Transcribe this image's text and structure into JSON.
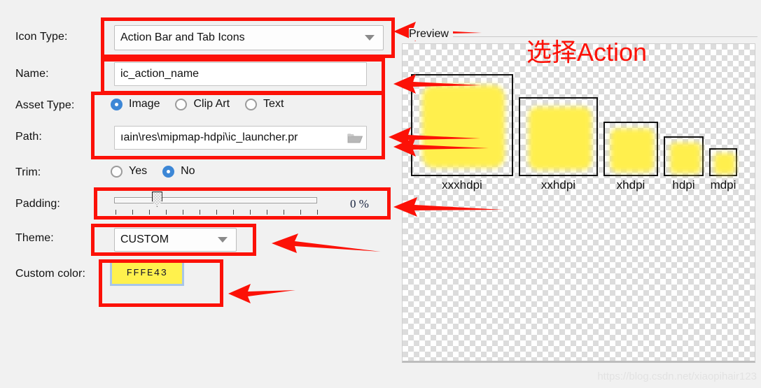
{
  "form": {
    "fields": [
      {
        "label": "Icon Type:",
        "value": "Action Bar and Tab Icons",
        "control": "combo"
      },
      {
        "label": "Name:",
        "value": "ic_action_name",
        "control": "textbox"
      },
      {
        "label": "Asset Type:",
        "control": "radio-group"
      },
      {
        "label": "Path:",
        "value": "ıain\\res\\mipmap-hdpi\\ic_launcher.pr",
        "control": "textbox"
      },
      {
        "label": "Trim:",
        "control": "radio-group"
      },
      {
        "label": "Padding:",
        "control": "slider"
      },
      {
        "label": "Theme:",
        "value": "CUSTOM",
        "control": "combo"
      },
      {
        "label": "Custom color:",
        "control": "color"
      }
    ],
    "asset_type": {
      "options": [
        "Image",
        "Clip Art",
        "Text"
      ],
      "selected": "Image"
    },
    "trim": {
      "options": [
        "Yes",
        "No"
      ],
      "selected": "No"
    },
    "padding": {
      "value": "0 %",
      "percent": 0,
      "thumb_position_percent": 21,
      "tick_count": 13
    },
    "custom_color": {
      "hex_label": "FFFE43",
      "swatch_color": "#fff14d",
      "border_color": "#a8c6e8"
    }
  },
  "preview": {
    "title": "Preview",
    "densities": [
      {
        "label": "xxxhdpi",
        "frame": 146,
        "icon": 118
      },
      {
        "label": "xxhdpi",
        "frame": 113,
        "icon": 90
      },
      {
        "label": "xhdpi",
        "frame": 78,
        "icon": 62
      },
      {
        "label": "hdpi",
        "frame": 57,
        "icon": 44
      },
      {
        "label": "mdpi",
        "frame": 40,
        "icon": 30
      }
    ]
  },
  "annotations": {
    "chinese_note": "选择Action",
    "accent_color": "#fc1107"
  },
  "watermark": "https://blog.csdn.net/xiaopihair123"
}
